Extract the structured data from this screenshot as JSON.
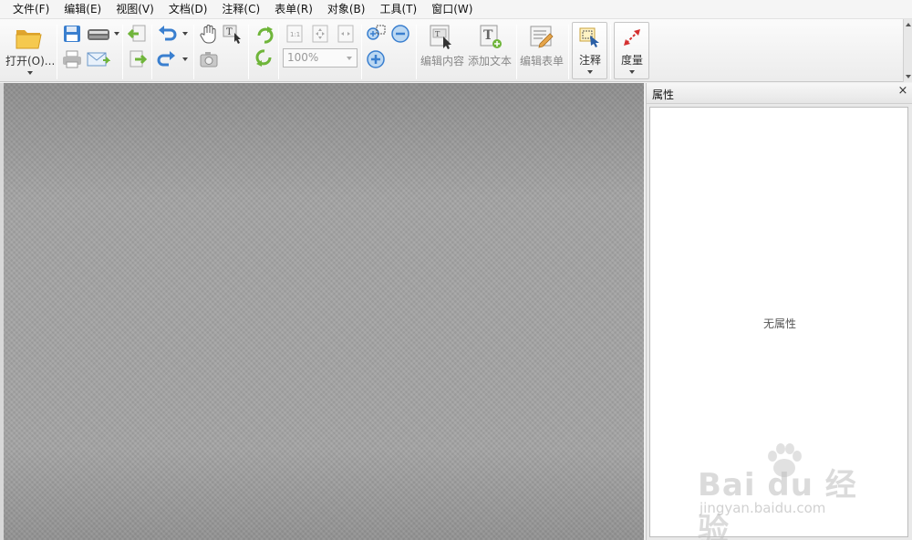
{
  "menu": [
    {
      "label": "文件(F)",
      "name": "menu-file"
    },
    {
      "label": "编辑(E)",
      "name": "menu-edit"
    },
    {
      "label": "视图(V)",
      "name": "menu-view"
    },
    {
      "label": "文档(D)",
      "name": "menu-document"
    },
    {
      "label": "注释(C)",
      "name": "menu-comment"
    },
    {
      "label": "表单(R)",
      "name": "menu-form"
    },
    {
      "label": "对象(B)",
      "name": "menu-object"
    },
    {
      "label": "工具(T)",
      "name": "menu-tools"
    },
    {
      "label": "窗口(W)",
      "name": "menu-window"
    }
  ],
  "toolbar": {
    "open_label": "打开(O)...",
    "zoom_value": "100%",
    "edit_content_label": "编辑内容",
    "add_text_label": "添加文本",
    "edit_form_label": "编辑表单",
    "annotation_label": "注释",
    "measure_label": "度量"
  },
  "panel": {
    "title": "属性",
    "close": "×",
    "empty_text": "无属性"
  },
  "watermark": {
    "brand": "Bai du 经验",
    "url": "jingyan.baidu.com"
  },
  "colors": {
    "accent_green": "#6fb53a",
    "accent_blue": "#3a7fcf",
    "folder_yellow": "#f2c14e",
    "doc_bg": "#a3a3a3"
  }
}
